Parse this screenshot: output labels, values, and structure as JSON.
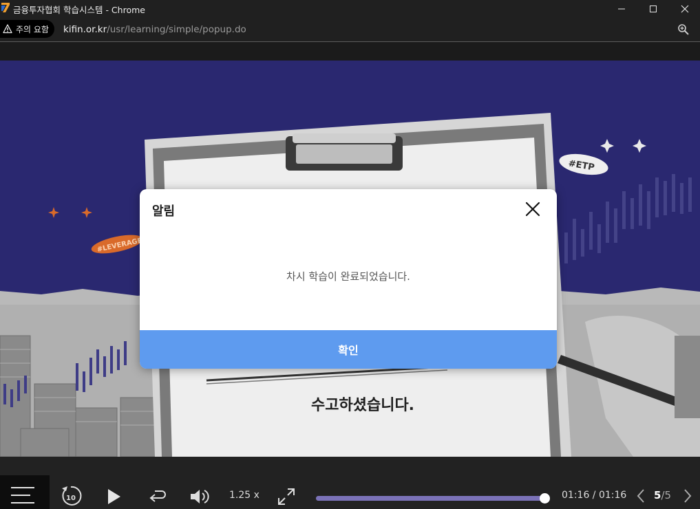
{
  "window": {
    "title": "금융투자협회 학습시스템 - Chrome",
    "minimize_label": "minimize",
    "maximize_label": "maximize",
    "close_label": "close"
  },
  "addressbar": {
    "security_label": "주의 요함",
    "url_host": "kifin.or.kr",
    "url_path": "/usr/learning/simple/popup.do"
  },
  "slide": {
    "caption": "수고하셨습니다.",
    "sticker_etp": "#ETP",
    "sticker_leverage": "#LEVERAGE"
  },
  "modal": {
    "title": "알림",
    "message": "차시 학습이 완료되었습니다.",
    "confirm_label": "확인",
    "close_icon": "close-icon"
  },
  "player": {
    "speed": "1.25 x",
    "current_time": "01:16",
    "total_time": "01:16",
    "time_separator": " / ",
    "progress_fraction": 1.0,
    "page_current": "5",
    "page_separator": "/",
    "page_total": "5",
    "accent_color": "#7b72b8",
    "confirm_color": "#5e9bef"
  }
}
